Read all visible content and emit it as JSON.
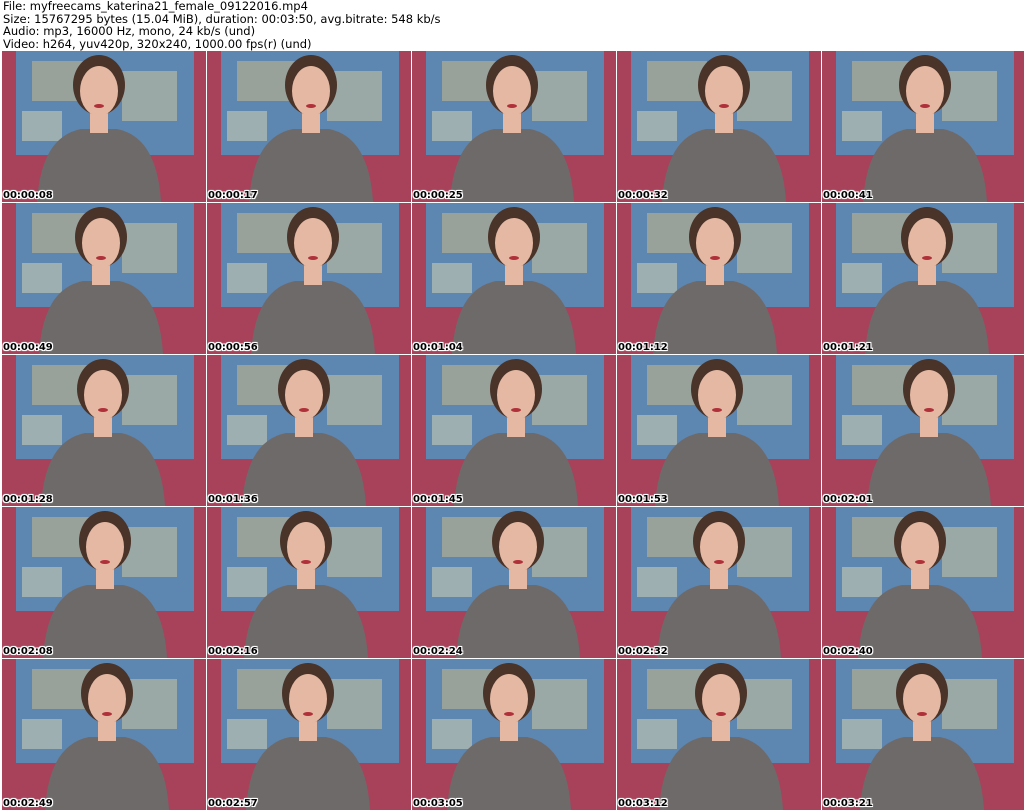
{
  "header": {
    "file_line": "File: myfreecams_katerina21_female_09122016.mp4",
    "size_line": "Size: 15767295 bytes (15.04 MiB), duration: 00:03:50, avg.bitrate: 548 kb/s",
    "audio_line": "Audio: mp3, 16000 Hz, mono, 24 kb/s (und)",
    "video_line": "Video: h264, yuv420p, 320x240, 1000.00 fps(r) (und)"
  },
  "thumbnails": [
    {
      "timestamp": "00:00:08"
    },
    {
      "timestamp": "00:00:17"
    },
    {
      "timestamp": "00:00:25"
    },
    {
      "timestamp": "00:00:32"
    },
    {
      "timestamp": "00:00:41"
    },
    {
      "timestamp": "00:00:49"
    },
    {
      "timestamp": "00:00:56"
    },
    {
      "timestamp": "00:01:04"
    },
    {
      "timestamp": "00:01:12"
    },
    {
      "timestamp": "00:01:21"
    },
    {
      "timestamp": "00:01:28"
    },
    {
      "timestamp": "00:01:36"
    },
    {
      "timestamp": "00:01:45"
    },
    {
      "timestamp": "00:01:53"
    },
    {
      "timestamp": "00:02:01"
    },
    {
      "timestamp": "00:02:08"
    },
    {
      "timestamp": "00:02:16"
    },
    {
      "timestamp": "00:02:24"
    },
    {
      "timestamp": "00:02:32"
    },
    {
      "timestamp": "00:02:40"
    },
    {
      "timestamp": "00:02:49"
    },
    {
      "timestamp": "00:02:57"
    },
    {
      "timestamp": "00:03:05"
    },
    {
      "timestamp": "00:03:12"
    },
    {
      "timestamp": "00:03:21"
    }
  ],
  "colors": {
    "background": "#ffffff",
    "wall": "#a8425a",
    "map": "#5d86b0",
    "sweater": "#6e6a6a",
    "hair": "#4a3328",
    "skin": "#e4b8a2"
  }
}
